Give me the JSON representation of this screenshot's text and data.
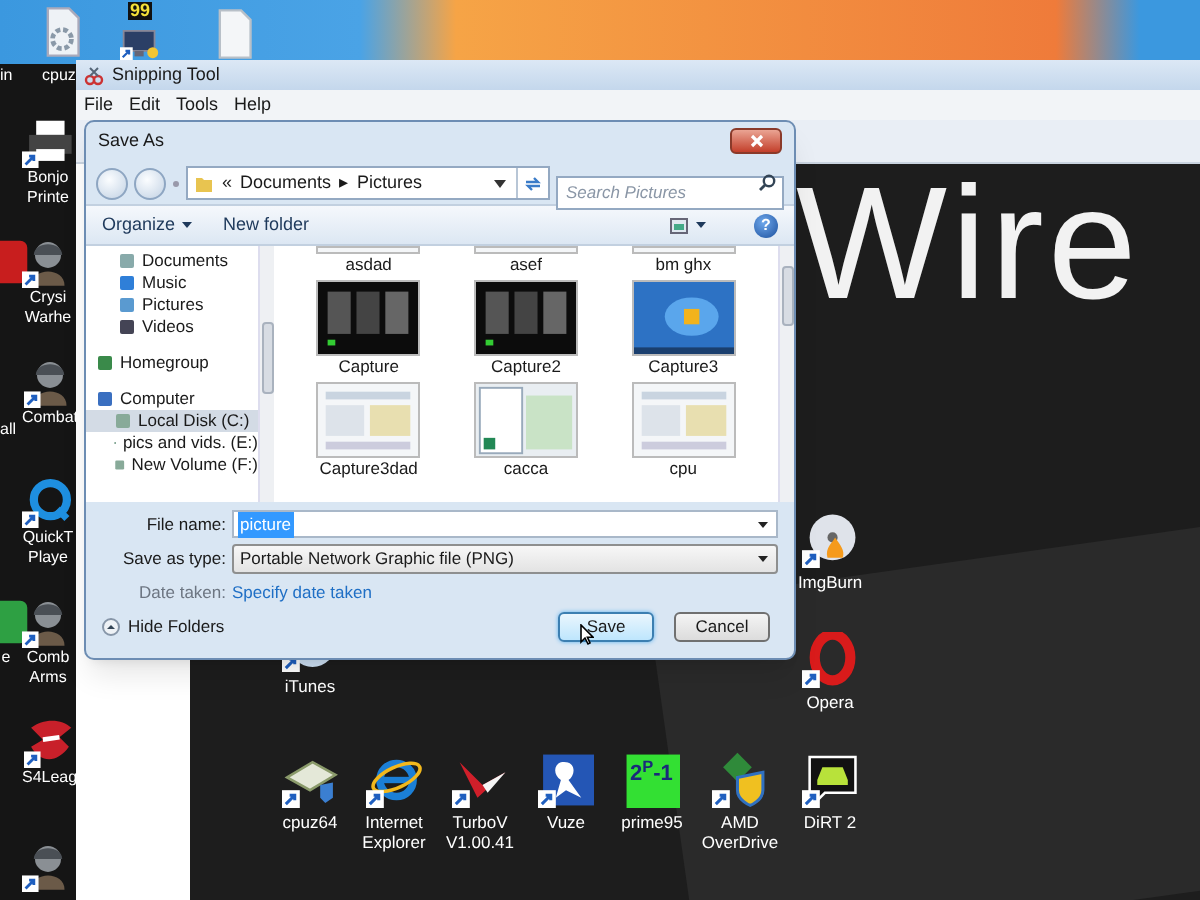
{
  "desktop": {
    "top_icons": [
      {
        "kind": "gear-file"
      },
      {
        "kind": "monitor",
        "badge": "99"
      },
      {
        "kind": "file"
      }
    ],
    "left_icons": [
      {
        "kind": "none",
        "lines": [
          "in"
        ]
      },
      {
        "kind": "none",
        "lines": [
          "cpuz"
        ]
      },
      {
        "kind": "printer",
        "lines": [
          "Bonjo",
          "Printe"
        ]
      },
      {
        "kind": "red-app"
      },
      {
        "kind": "figure",
        "lines": [
          "Crysi",
          "Warhe"
        ]
      },
      {
        "kind": "figure",
        "lines": [
          "Combat"
        ]
      },
      {
        "kind": "none",
        "lines": [
          "all"
        ]
      },
      {
        "kind": "ring",
        "lines": [
          "QuickT",
          "Playe"
        ]
      },
      {
        "kind": "green-app",
        "lines": [
          "e"
        ]
      },
      {
        "kind": "figure",
        "lines": [
          "Comb",
          "Arms"
        ]
      },
      {
        "kind": "emblem",
        "lines": [
          "S4Leag"
        ]
      },
      {
        "kind": "figure"
      }
    ]
  },
  "snipping_tool": {
    "title": "Snipping Tool",
    "menu": [
      "File",
      "Edit",
      "Tools",
      "Help"
    ],
    "capture": {
      "headline": "Wire",
      "icons": [
        {
          "label": "iTunes",
          "kind": "note"
        },
        {
          "label": "ImgBurn",
          "kind": "disc"
        },
        {
          "label": "Opera",
          "kind": "ring-red"
        },
        {
          "label": "cpuz64",
          "kind": "chip"
        },
        {
          "label": "Internet Explorer",
          "kind": "orbit"
        },
        {
          "label": "TurboV V1.00.41",
          "kind": "wing"
        },
        {
          "label": "Vuze",
          "kind": "frog"
        },
        {
          "label": "prime95",
          "kind": "tile",
          "badge": "2$^{P}$-1"
        },
        {
          "label": "AMD OverDrive",
          "kind": "shield"
        },
        {
          "label": "DiRT 2",
          "kind": "car"
        }
      ]
    }
  },
  "save_as": {
    "title": "Save As",
    "breadcrumb": [
      "«",
      "Documents",
      "▸",
      "Pictures"
    ],
    "search": {
      "placeholder": "Search Pictures"
    },
    "toolbar": {
      "organize": "Organize",
      "new_folder": "New folder",
      "help": "?"
    },
    "nav_pane": [
      {
        "label": "Documents",
        "kind": "document",
        "selected": false
      },
      {
        "label": "Music",
        "kind": "music",
        "selected": false
      },
      {
        "label": "Pictures",
        "kind": "pictures",
        "selected": false
      },
      {
        "label": "Videos",
        "kind": "videos",
        "selected": false
      },
      {
        "label": "Homegroup",
        "kind": "homegroup",
        "selected": false
      },
      {
        "label": "Computer",
        "kind": "computer",
        "selected": false,
        "children": [
          {
            "label": "Local Disk (C:)",
            "kind": "drive",
            "selected": true
          },
          {
            "label": "pics and vids. (E:)",
            "kind": "drive",
            "selected": false
          },
          {
            "label": "New Volume (F:)",
            "kind": "drive",
            "selected": false
          }
        ]
      }
    ],
    "files": [
      {
        "label": "asdad"
      },
      {
        "label": "asef"
      },
      {
        "label": "bm ghx"
      },
      {
        "label": "Capture"
      },
      {
        "label": "Capture2"
      },
      {
        "label": "Capture3"
      },
      {
        "label": "Capture3dad"
      },
      {
        "label": "cacca"
      },
      {
        "label": "cpu"
      }
    ],
    "file_name": {
      "label": "File name:",
      "value": "picture",
      "selected": true
    },
    "save_type": {
      "label": "Save as type:",
      "value": "Portable Network Graphic file (PNG)"
    },
    "date_taken": {
      "label": "Date taken:",
      "link": "Specify date taken"
    },
    "hide_folders": "Hide Folders",
    "buttons": [
      {
        "label": "Save",
        "focused": true
      },
      {
        "label": "Cancel",
        "focused": false
      }
    ]
  }
}
